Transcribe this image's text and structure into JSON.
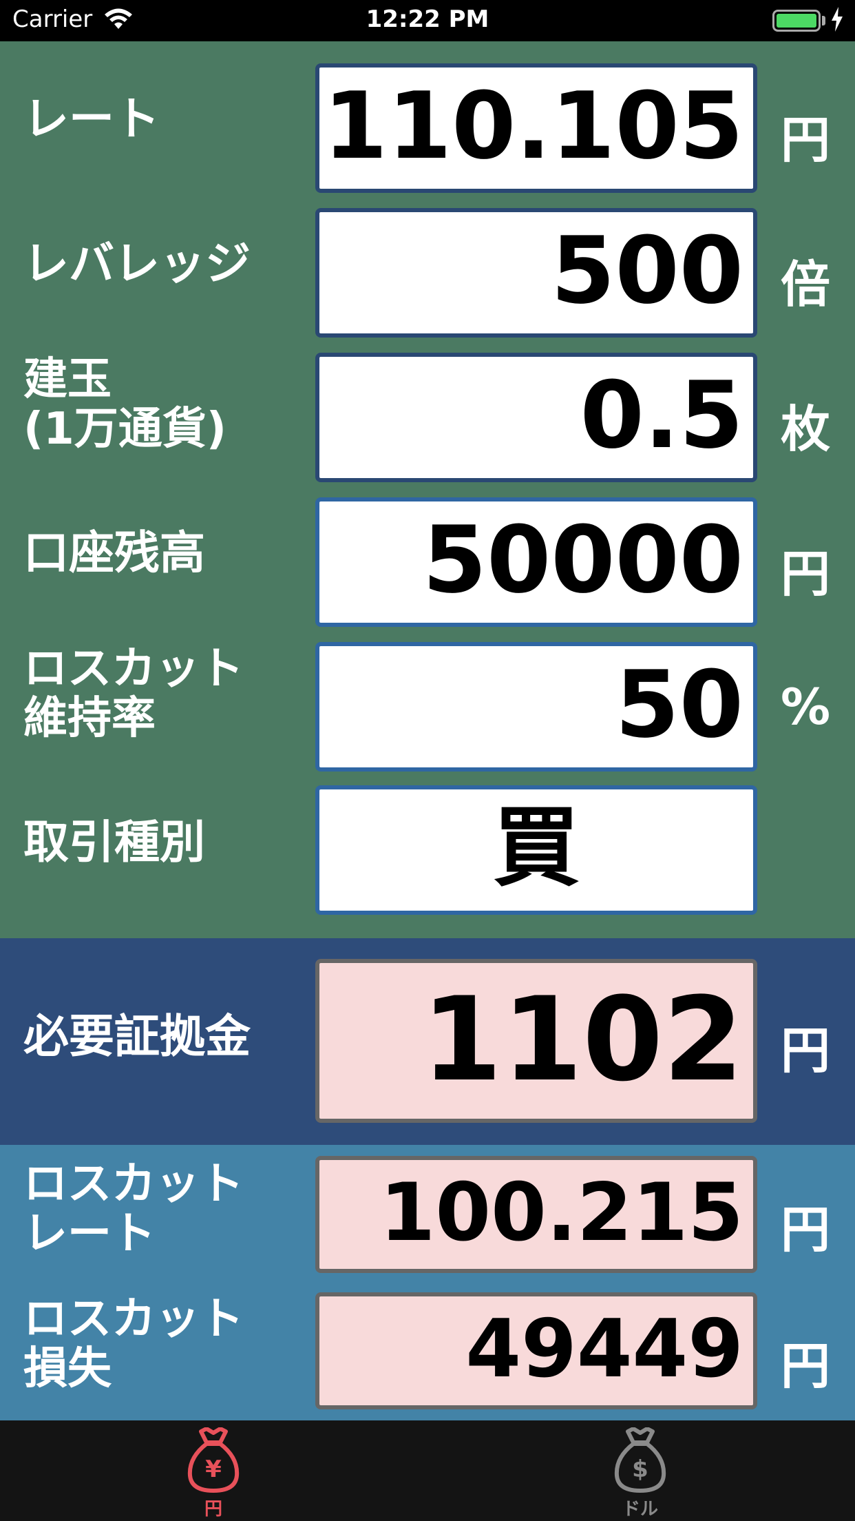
{
  "status_bar": {
    "carrier": "Carrier",
    "time": "12:22 PM"
  },
  "rows": {
    "rate": {
      "label": "レート",
      "value": "110.105",
      "unit": "円"
    },
    "leverage": {
      "label": "レバレッジ",
      "value": "500",
      "unit": "倍"
    },
    "position": {
      "label_line1": "建玉",
      "label_line2": "(1万通貨)",
      "value": "0.5",
      "unit": "枚"
    },
    "balance": {
      "label": "口座残高",
      "value": "50000",
      "unit": "円"
    },
    "maintenance": {
      "label_line1": "ロスカット",
      "label_line2": "維持率",
      "value": "50",
      "unit": "%"
    },
    "trade_type": {
      "label": "取引種別",
      "value": "買"
    }
  },
  "results": {
    "required_margin": {
      "label": "必要証拠金",
      "value": "1102",
      "unit": "円"
    },
    "losscut_rate": {
      "label_line1": "ロスカット",
      "label_line2": "レート",
      "value": "100.215",
      "unit": "円"
    },
    "losscut_loss": {
      "label_line1": "ロスカット",
      "label_line2": "損失",
      "value": "49449",
      "unit": "円"
    }
  },
  "tabs": [
    {
      "label": "円",
      "icon": "yen-money-bag-icon",
      "active": true,
      "color": "#e8515a"
    },
    {
      "label": "ドル",
      "icon": "dollar-money-bag-icon",
      "active": false,
      "color": "#8a8a8a"
    }
  ]
}
